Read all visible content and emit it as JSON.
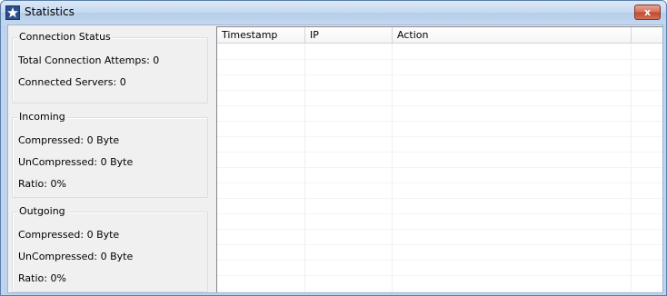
{
  "window": {
    "title": "Statistics",
    "close_glyph": "x"
  },
  "connection": {
    "legend": "Connection Status",
    "total_attempts": "Total Connection Attemps: 0",
    "connected_servers": "Connected Servers: 0"
  },
  "incoming": {
    "legend": "Incoming",
    "compressed": "Compressed: 0 Byte",
    "uncompressed": "UnCompressed: 0 Byte",
    "ratio": "Ratio: 0%"
  },
  "outgoing": {
    "legend": "Outgoing",
    "compressed": "Compressed: 0 Byte",
    "uncompressed": "UnCompressed: 0 Byte",
    "ratio": "Ratio: 0%"
  },
  "log": {
    "columns": [
      "Timestamp",
      "IP",
      "Action",
      ""
    ],
    "rows": []
  },
  "icons": {
    "app": "star-icon",
    "close": "close-icon"
  }
}
